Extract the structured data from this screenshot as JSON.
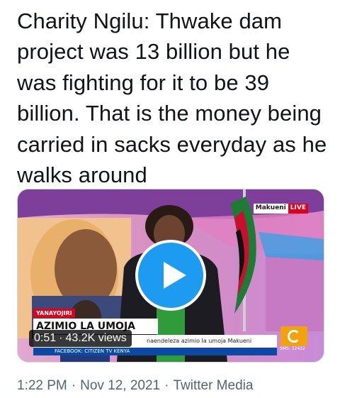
{
  "tweet": {
    "text": "Charity Ngilu: Thwake dam project was 13 billion but he was fighting for it to be 39 billion. That is the money being carried in sacks everyday as he walks around"
  },
  "media": {
    "live_location": "Makueni",
    "live_label": "LIVE",
    "ticker_tag": "YANAYOJIRI",
    "ticker_title": "AZIMIO LA UMOJA",
    "ticker_body": "naendeleza azimio la umoja Makueni",
    "ticker_footer": "FACEBOOK: CITIZEN TV KENYA",
    "sms_text": "SMS: 22422",
    "duration": "0:51",
    "views": "43.2K views",
    "play_icon": "play-icon",
    "logo_icon": "citizen-tv-logo"
  },
  "meta": {
    "time": "1:22 PM",
    "date": "Nov 12, 2021",
    "source": "Twitter Media",
    "separator": "·"
  },
  "colors": {
    "text_primary": "#0f1419",
    "text_secondary": "#536471",
    "accent": "#1d9bf0",
    "live_red": "#e0001b"
  }
}
